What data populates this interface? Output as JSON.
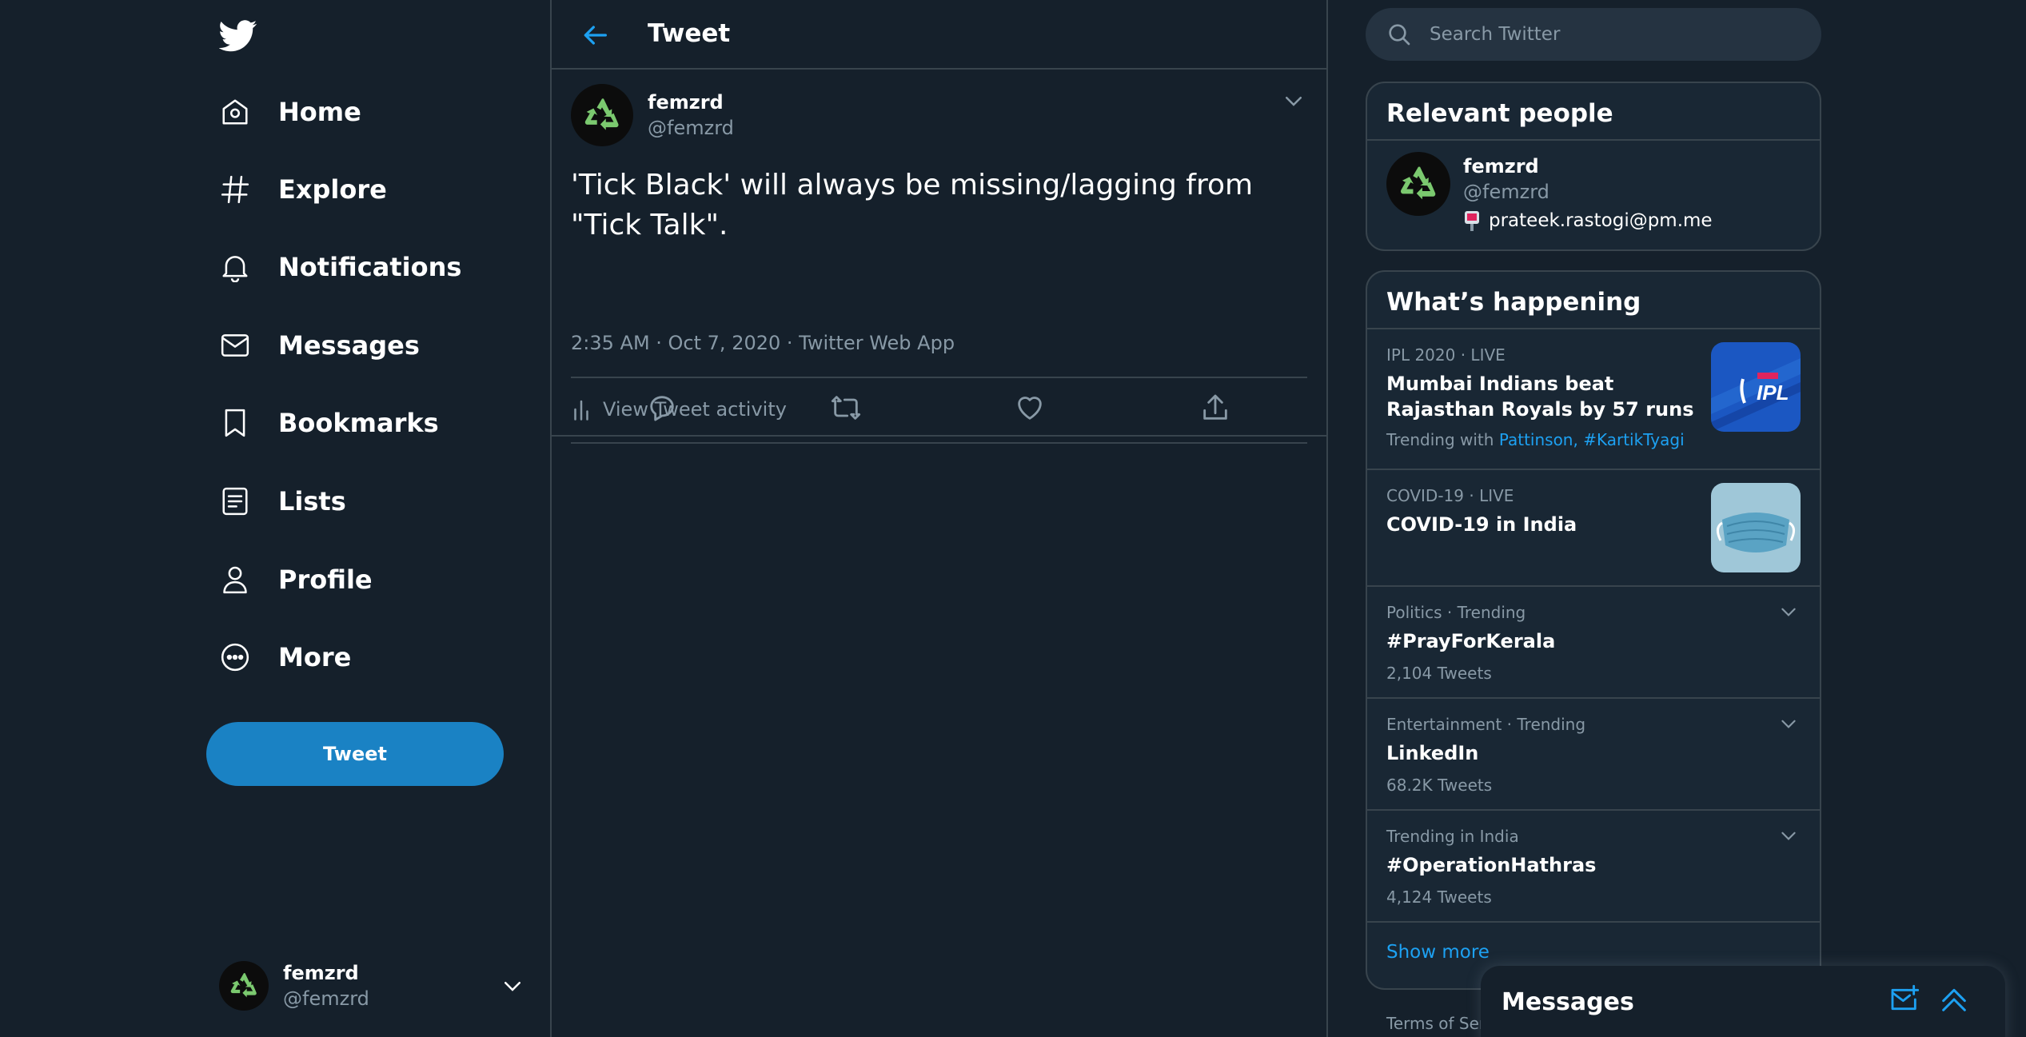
{
  "colors": {
    "background": "#15202b",
    "panel": "#192734",
    "border": "#38444d",
    "accent": "#1da1f2",
    "button": "#1a82c4",
    "secondary_text": "#8899a6",
    "avatar_recycle": "#7bc96f"
  },
  "nav": {
    "logo_icon": "twitter-bird-icon",
    "items": [
      {
        "label": "Home",
        "icon": "home-icon"
      },
      {
        "label": "Explore",
        "icon": "hashtag-icon"
      },
      {
        "label": "Notifications",
        "icon": "bell-icon"
      },
      {
        "label": "Messages",
        "icon": "envelope-icon"
      },
      {
        "label": "Bookmarks",
        "icon": "bookmark-icon"
      },
      {
        "label": "Lists",
        "icon": "list-icon"
      },
      {
        "label": "Profile",
        "icon": "person-icon"
      },
      {
        "label": "More",
        "icon": "more-circle-icon"
      }
    ],
    "tweet_button": "Tweet",
    "account": {
      "name": "femzrd",
      "handle": "@femzrd"
    }
  },
  "main": {
    "header_title": "Tweet",
    "tweet": {
      "author_name": "femzrd",
      "author_handle": "@femzrd",
      "text": "'Tick Black' will always be missing/lagging from \"Tick Talk\".",
      "meta": "2:35 AM · Oct 7, 2020 · Twitter Web App",
      "activity_label": "View Tweet activity",
      "actions": [
        "reply-icon",
        "retweet-icon",
        "like-icon",
        "share-icon"
      ]
    }
  },
  "sidebar": {
    "search_placeholder": "Search Twitter",
    "relevant": {
      "title": "Relevant people",
      "person": {
        "name": "femzrd",
        "handle": "@femzrd",
        "bio": "prateek.rastogi@pm.me"
      }
    },
    "happening": {
      "title": "What’s happening",
      "trends": [
        {
          "context": "IPL 2020 · LIVE",
          "title": "Mumbai Indians beat Rajasthan Royals by 57 runs",
          "trending_with_label": "Trending with",
          "trending_with": "Pattinson, #KartikTyagi",
          "thumb": "ipl-logo"
        },
        {
          "context": "COVID-19 · LIVE",
          "title": "COVID-19 in India",
          "thumb": "face-mask"
        },
        {
          "context": "Politics · Trending",
          "title": "#PrayForKerala",
          "count": "2,104 Tweets"
        },
        {
          "context": "Entertainment · Trending",
          "title": "LinkedIn",
          "count": "68.2K Tweets"
        },
        {
          "context": "Trending in India",
          "title": "#OperationHathras",
          "count": "4,124 Tweets"
        }
      ],
      "show_more": "Show more"
    },
    "footer": "Terms of Serv"
  },
  "messages_drawer": {
    "title": "Messages"
  }
}
